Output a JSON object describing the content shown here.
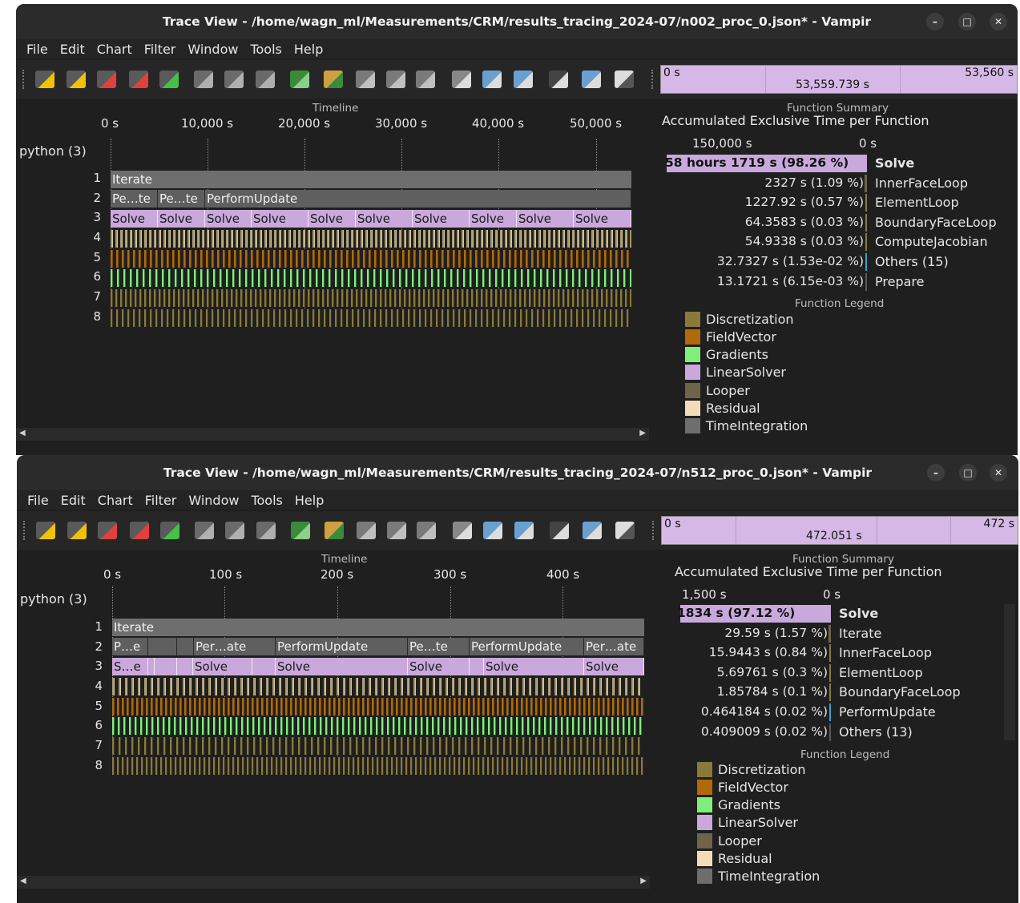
{
  "colors": {
    "Discretization": "#8a7a3a",
    "FieldVector": "#b06a0a",
    "Gradients": "#7ef07a",
    "LinearSolver": "#c9a8dc",
    "Looper": "#6f6448",
    "Residual": "#f2dcb8",
    "TimeIntegration": "#6e6e6e"
  },
  "windows": [
    {
      "title": "Trace View - /home/wagn_ml/Measurements/CRM/results_tracing_2024-07/n002_proc_0.json* - Vampir",
      "menu": [
        "File",
        "Edit",
        "Chart",
        "Filter",
        "Window",
        "Tools",
        "Help"
      ],
      "overview": {
        "start": "0 s",
        "end": "53,560 s",
        "center": "53,559.739 s"
      },
      "timeline": {
        "title": "Timeline",
        "ticks": [
          "0 s",
          "10,000 s",
          "20,000 s",
          "30,000 s",
          "40,000 s",
          "50,000 s"
        ],
        "process": "python (3)",
        "rows": [
          "1",
          "2",
          "3",
          "4",
          "5",
          "6",
          "7",
          "8"
        ],
        "iterate_label": "Iterate",
        "row2": [
          "Pe…te",
          "Pe…te",
          "PerformUpdate"
        ],
        "row3": [
          "Solve",
          "Solve",
          "Solve",
          "Solve",
          "Solve",
          "Solve",
          "Solve",
          "Solve",
          "Solve",
          "Solve"
        ]
      },
      "summary": {
        "title": "Function Summary",
        "heading": "Accumulated Exclusive Time per Function",
        "axis_left": "150,000 s",
        "axis_right": "0 s",
        "rows": [
          {
            "value": "58 hours 1719 s (98.26 %)",
            "name": "Solve",
            "fraction": 0.9826
          },
          {
            "value": "2327 s (1.09 %)",
            "name": "InnerFaceLoop",
            "fraction": 0.0109
          },
          {
            "value": "1227.92 s (0.57 %)",
            "name": "ElementLoop",
            "fraction": 0.0057
          },
          {
            "value": "64.3583 s (0.03 %)",
            "name": "BoundaryFaceLoop",
            "fraction": 0.0003
          },
          {
            "value": "54.9338 s (0.03 %)",
            "name": "ComputeJacobian",
            "fraction": 0.0003
          },
          {
            "value": "32.7327 s (1.53e-02 %)",
            "name": "Others (15)",
            "fraction": 0.0002
          },
          {
            "value": "13.1721 s (6.15e-03 %)",
            "name": "Prepare",
            "fraction": 0.0001
          }
        ]
      },
      "legend": {
        "title": "Function Legend",
        "items": [
          "Discretization",
          "FieldVector",
          "Gradients",
          "LinearSolver",
          "Looper",
          "Residual",
          "TimeIntegration"
        ]
      }
    },
    {
      "title": "Trace View - /home/wagn_ml/Measurements/CRM/results_tracing_2024-07/n512_proc_0.json* - Vampir",
      "menu": [
        "File",
        "Edit",
        "Chart",
        "Filter",
        "Window",
        "Tools",
        "Help"
      ],
      "overview": {
        "start": "0 s",
        "end": "472 s",
        "center": "472.051 s"
      },
      "timeline": {
        "title": "Timeline",
        "ticks": [
          "0 s",
          "100 s",
          "200 s",
          "300 s",
          "400 s"
        ],
        "process": "python (3)",
        "rows": [
          "1",
          "2",
          "3",
          "4",
          "5",
          "6",
          "7",
          "8"
        ],
        "iterate_label": "Iterate",
        "row2": [
          "P…e",
          "Per…ate",
          "PerformUpdate",
          "Pe…te",
          "PerformUpdate",
          "Per…ate"
        ],
        "row3": [
          "S…e",
          "Solve",
          "Solve",
          "Solve",
          "Solve",
          "Solve"
        ]
      },
      "summary": {
        "title": "Function Summary",
        "heading": "Accumulated Exclusive Time per Function",
        "axis_left": "1,500 s",
        "axis_right": "0 s",
        "rows": [
          {
            "value": "1834 s (97.12 %)",
            "name": "Solve",
            "fraction": 0.9712
          },
          {
            "value": "29.59 s (1.57 %)",
            "name": "Iterate",
            "fraction": 0.0157
          },
          {
            "value": "15.9443 s (0.84 %)",
            "name": "InnerFaceLoop",
            "fraction": 0.0084
          },
          {
            "value": "5.69761 s (0.3 %)",
            "name": "ElementLoop",
            "fraction": 0.003
          },
          {
            "value": "1.85784 s (0.1 %)",
            "name": "BoundaryFaceLoop",
            "fraction": 0.001
          },
          {
            "value": "0.464184 s (0.02 %)",
            "name": "PerformUpdate",
            "fraction": 0.0002
          },
          {
            "value": "0.409009 s (0.02 %)",
            "name": "Others (13)",
            "fraction": 0.0002
          }
        ]
      },
      "legend": {
        "title": "Function Legend",
        "items": [
          "Discretization",
          "FieldVector",
          "Gradients",
          "LinearSolver",
          "Looper",
          "Residual",
          "TimeIntegration"
        ]
      }
    }
  ]
}
